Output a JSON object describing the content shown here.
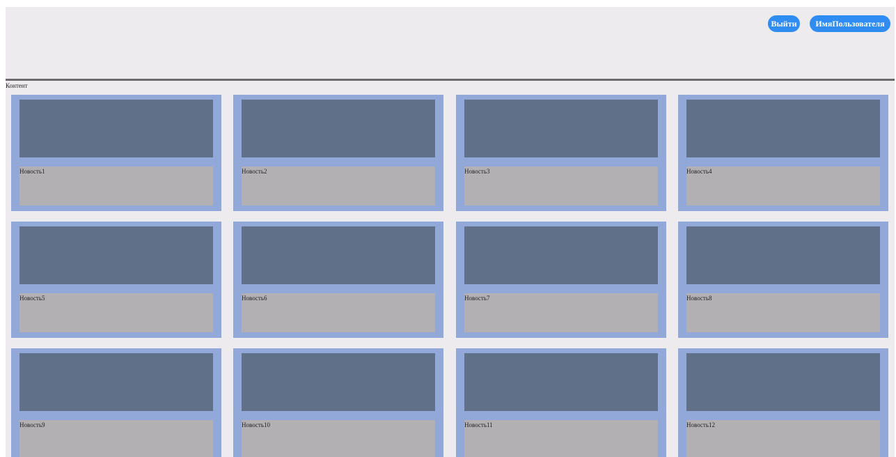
{
  "header": {
    "logout_label": "Выйти",
    "username_label": "ИмяПользователя"
  },
  "content": {
    "label": "Контент"
  },
  "news": [
    {
      "title": "Новость1"
    },
    {
      "title": "Новость2"
    },
    {
      "title": "Новость3"
    },
    {
      "title": "Новость4"
    },
    {
      "title": "Новость5"
    },
    {
      "title": "Новость6"
    },
    {
      "title": "Новость7"
    },
    {
      "title": "Новость8"
    },
    {
      "title": "Новость9"
    },
    {
      "title": "Новость10"
    },
    {
      "title": "Новость11"
    },
    {
      "title": "Новость12"
    }
  ],
  "colors": {
    "page_background": "#eeebef",
    "button": "#2f8cf3",
    "card_frame": "#91a8d8",
    "card_image": "#617089",
    "card_body": "#b3b0b4",
    "header_divider": "#6b6b6b"
  }
}
